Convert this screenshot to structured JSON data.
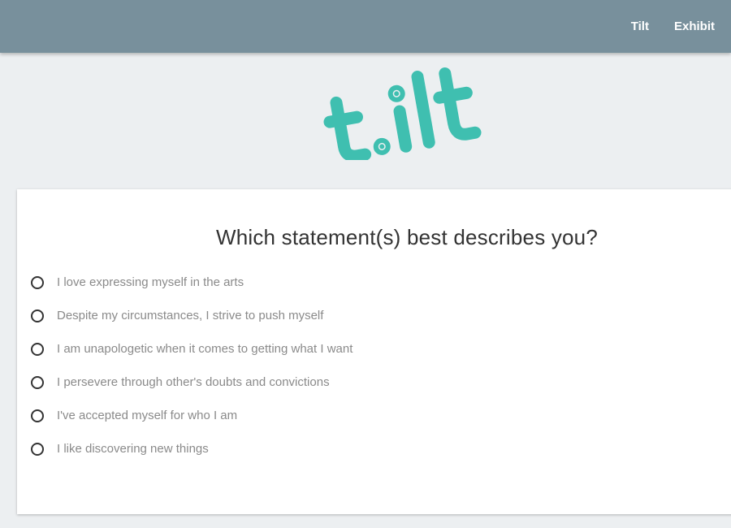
{
  "nav": {
    "items": [
      {
        "label": "Tilt"
      },
      {
        "label": "Exhibit"
      }
    ]
  },
  "logo": {
    "text": "t.ilt",
    "color": "#3fbfb0"
  },
  "colors": {
    "header": "#78909c",
    "background": "#eceff1",
    "card": "#ffffff",
    "option_text": "#8a8a8a"
  },
  "quiz": {
    "question": "Which statement(s) best describes you?",
    "options": [
      {
        "label": "I love expressing myself in the arts",
        "selected": false
      },
      {
        "label": "Despite my circumstances, I strive to push myself",
        "selected": false
      },
      {
        "label": "I am unapologetic when it comes to getting what I want",
        "selected": false
      },
      {
        "label": "I persevere through other's doubts and convictions",
        "selected": false
      },
      {
        "label": "I've accepted myself for who I am",
        "selected": false
      },
      {
        "label": "I like discovering new things",
        "selected": false
      }
    ]
  }
}
